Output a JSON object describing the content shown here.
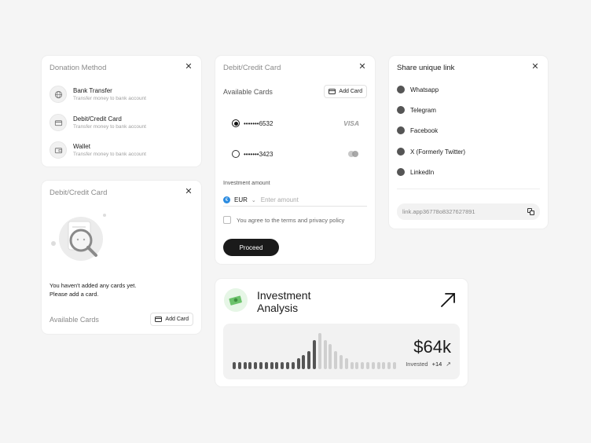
{
  "donation": {
    "title": "Donation Method",
    "items": [
      {
        "label": "Bank Transfer",
        "sub": "Transfer money to bank account",
        "icon": "globe-icon"
      },
      {
        "label": "Debit/Credit Card",
        "sub": "Transfer money to bank account",
        "icon": "card-icon"
      },
      {
        "label": "Wallet",
        "sub": "Transfer money to bank account",
        "icon": "wallet-icon"
      }
    ]
  },
  "empty_card": {
    "title": "Debit/Credit Card",
    "message_line1": "You haven't added any cards yet.",
    "message_line2": "Please add a card.",
    "available": "Available Cards",
    "add_label": "Add Card"
  },
  "payment": {
    "title": "Debit/Credit Card",
    "available": "Available Cards",
    "add_label": "Add Card",
    "cards": [
      {
        "number": "•••••••6532",
        "brand": "VISA",
        "selected": true
      },
      {
        "number": "•••••••3423",
        "brand": "",
        "selected": false
      }
    ],
    "amount_label": "Investment amount",
    "currency": "EUR",
    "amount_placeholder": "Enter amount",
    "terms": "You agree to the terms and privacy policy",
    "proceed": "Proceed"
  },
  "share": {
    "title": "Share unique link",
    "items": [
      {
        "label": "Whatsapp",
        "icon": "whatsapp-icon"
      },
      {
        "label": "Telegram",
        "icon": "telegram-icon"
      },
      {
        "label": "Facebook",
        "icon": "facebook-icon"
      },
      {
        "label": "X (Formerly Twitter)",
        "icon": "x-icon"
      },
      {
        "label": "LinkedIn",
        "icon": "linkedin-icon"
      }
    ],
    "link": "link.app36778o8327627891"
  },
  "investment": {
    "title_line1": "Investment",
    "title_line2": "Analysis",
    "value": "$64k",
    "invested_label": "Invested",
    "change": "+14"
  },
  "chart_data": {
    "type": "bar",
    "values": [
      2,
      2,
      2,
      2,
      2,
      2,
      2,
      2,
      2,
      2,
      2,
      2,
      3,
      4,
      5,
      8,
      10,
      8,
      7,
      5,
      4,
      3,
      2,
      2,
      2,
      2,
      2,
      2,
      2,
      2,
      2
    ],
    "highlight_range": [
      0,
      15
    ]
  }
}
